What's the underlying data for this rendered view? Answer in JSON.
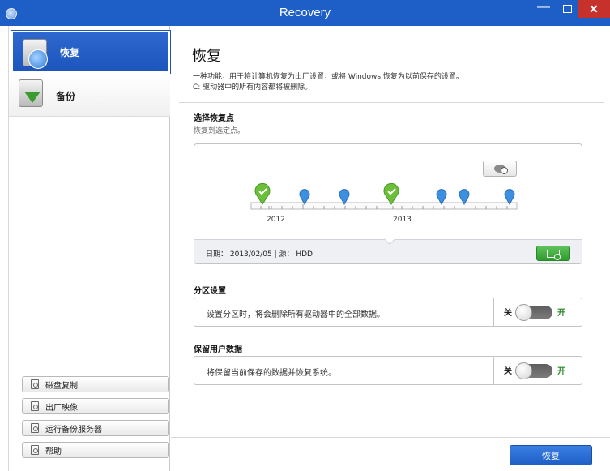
{
  "window": {
    "title": "Recovery",
    "close_glyph": "✕",
    "minimize_glyph": "—"
  },
  "sidebar": {
    "nav": [
      {
        "label": "恢复",
        "icon": "recovery-disk-icon",
        "selected": true
      },
      {
        "label": "备份",
        "icon": "backup-download-icon",
        "selected": false
      }
    ],
    "buttons": [
      {
        "label": "磁盘复制",
        "icon": "disk-copy-icon"
      },
      {
        "label": "出厂映像",
        "icon": "factory-image-icon"
      },
      {
        "label": "运行备份服务器",
        "icon": "backup-server-icon"
      },
      {
        "label": "帮助",
        "icon": "help-icon"
      }
    ]
  },
  "main": {
    "title": "恢复",
    "description_line1": "一种功能，用于将计算机恢复为出厂设置，或将 Windows 恢复为以前保存的设置。",
    "description_line2": "C: 驱动器中的所有内容都将被删除。",
    "restore_point": {
      "heading": "选择恢复点",
      "subheading": "恢复到选定点。",
      "year_labels": [
        "2012",
        "2013"
      ],
      "footer_text": "日期：  2013/02/05   |   源：  HDD",
      "markers": [
        {
          "type": "check",
          "color": "#6cbf3a"
        },
        {
          "type": "pin",
          "color": "#3d8fe0"
        },
        {
          "type": "pin",
          "color": "#3d8fe0"
        },
        {
          "type": "check",
          "color": "#6cbf3a"
        },
        {
          "type": "pin",
          "color": "#3d8fe0"
        },
        {
          "type": "pin",
          "color": "#3d8fe0"
        },
        {
          "type": "pin",
          "color": "#3d8fe0"
        }
      ]
    },
    "partition": {
      "heading": "分区设置",
      "text": "设置分区时，将会删除所有驱动器中的全部数据。",
      "off_label": "关",
      "on_label": "开",
      "state": "off"
    },
    "keep_data": {
      "heading": "保留用户数据",
      "text": "将保留当前保存的数据并恢复系统。",
      "off_label": "关",
      "on_label": "开",
      "state": "off"
    },
    "primary_button": "恢复"
  },
  "colors": {
    "titlebar": "#1d5fc6",
    "close": "#c7312b",
    "accent_green": "#3aa637",
    "accent_blue": "#1d5fc6"
  }
}
